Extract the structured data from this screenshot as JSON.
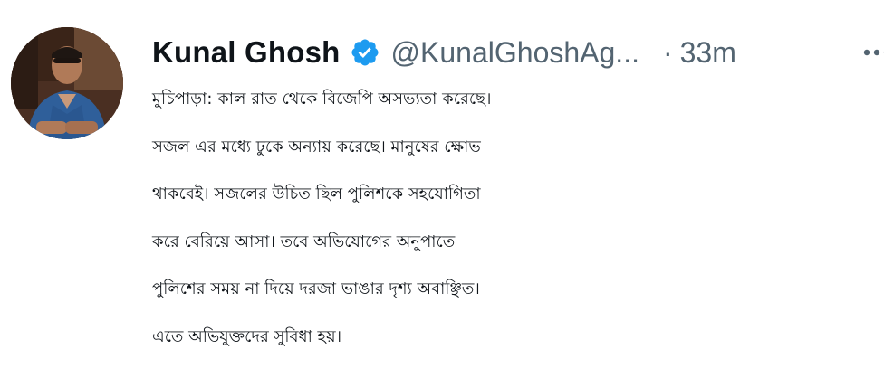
{
  "tweet": {
    "author_name": "Kunal Ghosh",
    "handle": "@KunalGhoshAg...",
    "separator": "·",
    "time": "33m",
    "verified_icon": "verified-badge-icon",
    "verified_color": "#1d9bf0",
    "more_icon": "more-options-icon",
    "text_lines": [
      "মুচিপাড়া: কাল রাত থেকে বিজেপি অসভ্যতা করেছে।",
      "সজল এর মধ্যে ঢুকে অন্যায় করেছে। মানুষের ক্ষোভ",
      "থাকবেই। সজলের উচিত ছিল পুলিশকে সহযোগিতা",
      "করে বেরিয়ে আসা। তবে অভিযোগের অনুপাতে",
      "পুলিশের সময় না দিয়ে দরজা ভাঙার দৃশ্য অবাঞ্ছিত।",
      "এতে অভিযুক্তদের সুবিধা হয়।"
    ]
  }
}
